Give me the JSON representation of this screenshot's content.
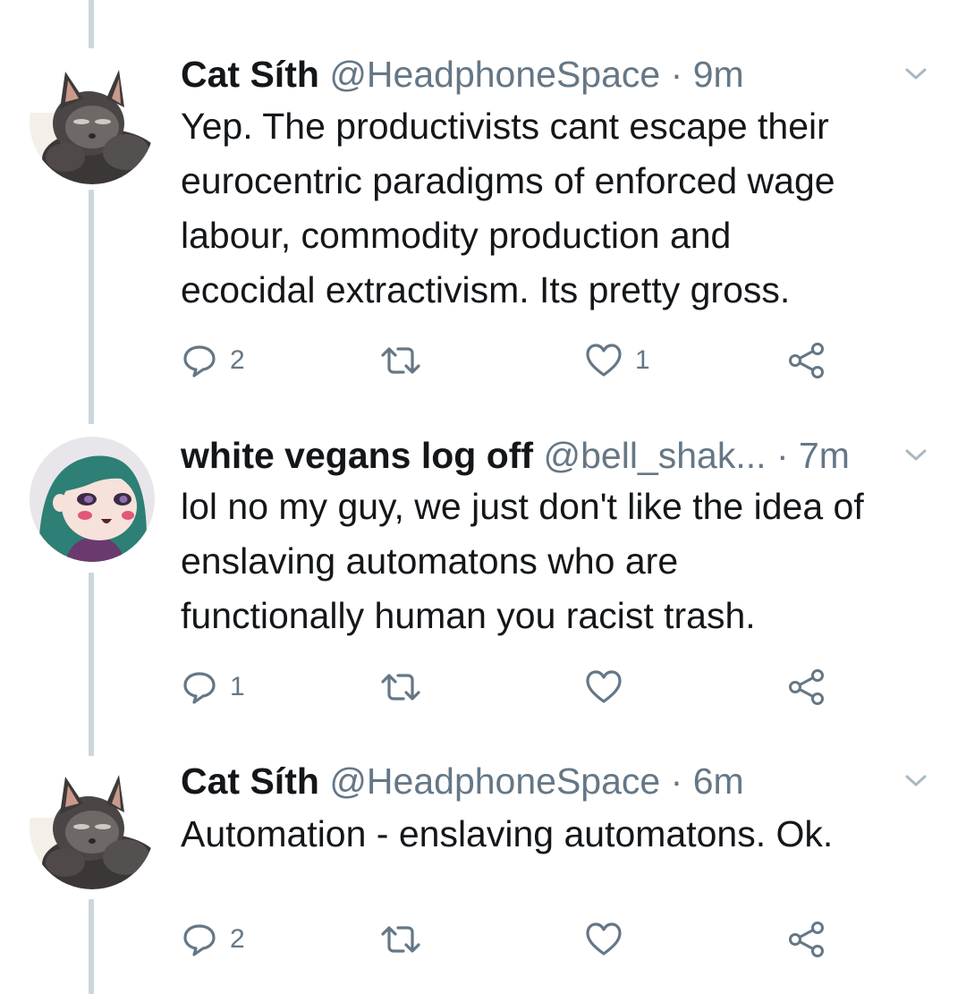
{
  "tweets": [
    {
      "name": "Cat Síth",
      "handle": "@HeadphoneSpace",
      "separator": "·",
      "time": "9m",
      "body_lines": [
        "Yep. The productivists cant escape their",
        "eurocentric paradigms of enforced wage",
        "labour, commodity production and",
        "ecocidal extractivism. Its pretty gross."
      ],
      "replies": "2",
      "retweets": "",
      "likes": "1",
      "avatar": "cat-avatar"
    },
    {
      "name": "white vegans log off",
      "handle": "@bell_shak...",
      "separator": "·",
      "time": "7m",
      "body_lines": [
        "lol no my guy, we just don't like the idea of",
        "enslaving automatons who are",
        "functionally human you racist trash."
      ],
      "replies": "1",
      "retweets": "",
      "likes": "",
      "avatar": "cartoon-girl-avatar"
    },
    {
      "name": "Cat Síth",
      "handle": "@HeadphoneSpace",
      "separator": "·",
      "time": "6m",
      "body_lines": [
        "Automation - enslaving automatons. Ok."
      ],
      "replies": "2",
      "retweets": "",
      "likes": "",
      "avatar": "cat-avatar"
    }
  ],
  "icons": {
    "reply": "reply-icon",
    "retweet": "retweet-icon",
    "like": "heart-icon",
    "share": "share-icon",
    "menu": "chevron-down-icon"
  },
  "colors": {
    "text": "#14171a",
    "secondary": "#657786",
    "thread_line": "#ccd6dd"
  }
}
